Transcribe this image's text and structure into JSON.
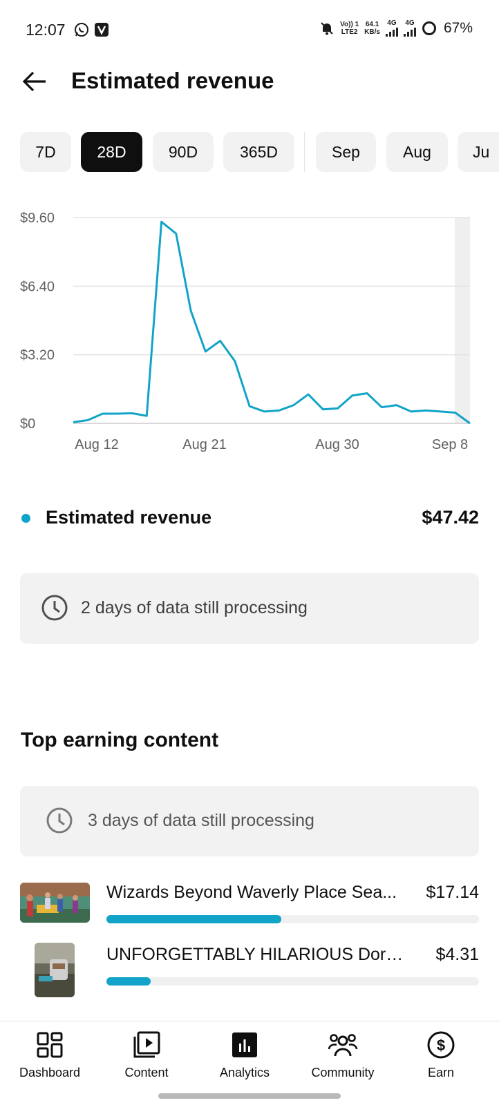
{
  "status_bar": {
    "time": "12:07",
    "volte": "Vo)) 1",
    "lte": "LTE2",
    "speed_value": "64.1",
    "speed_unit": "KB/s",
    "net1": "4G",
    "net2": "4G",
    "battery": "67%"
  },
  "header": {
    "title": "Estimated revenue"
  },
  "chips": [
    "7D",
    "28D",
    "90D",
    "365D",
    "Sep",
    "Aug",
    "Ju"
  ],
  "active_chip": "28D",
  "chart_data": {
    "type": "line",
    "title": "",
    "xlabel": "",
    "ylabel": "",
    "y_ticks": [
      "$9.60",
      "$6.40",
      "$3.20",
      "$0"
    ],
    "x_ticks": [
      "Aug 12",
      "Aug 21",
      "Aug 30",
      "Sep 8"
    ],
    "ylim": [
      0,
      9.6
    ],
    "x": [
      "Aug 12",
      "Aug 13",
      "Aug 14",
      "Aug 15",
      "Aug 16",
      "Aug 17",
      "Aug 18",
      "Aug 19",
      "Aug 20",
      "Aug 21",
      "Aug 22",
      "Aug 23",
      "Aug 24",
      "Aug 25",
      "Aug 26",
      "Aug 27",
      "Aug 28",
      "Aug 29",
      "Aug 30",
      "Aug 31",
      "Sep 1",
      "Sep 2",
      "Sep 3",
      "Sep 4",
      "Sep 5",
      "Sep 6",
      "Sep 7",
      "Sep 8"
    ],
    "series": [
      {
        "name": "Estimated revenue",
        "color": "#11a4c8",
        "values": [
          0.05,
          0.15,
          0.45,
          0.45,
          0.47,
          0.35,
          9.4,
          8.85,
          5.25,
          3.35,
          3.85,
          2.9,
          0.8,
          0.55,
          0.6,
          0.85,
          1.35,
          0.65,
          0.7,
          1.3,
          1.4,
          0.75,
          0.85,
          0.55,
          0.6,
          0.55,
          0.5,
          0.0
        ]
      }
    ],
    "processing_band": true,
    "grid": true
  },
  "summary": {
    "label": "Estimated revenue",
    "value": "$47.42"
  },
  "notice_1": "2 days of data still processing",
  "section_title": "Top earning content",
  "notice_2": "3 days of data still processing",
  "top_content": [
    {
      "title": "Wizards Beyond Waverly Place Sea...",
      "value": "$17.14",
      "share": 0.469
    },
    {
      "title": "UNFORGETTABLY HILARIOUS Dort ...",
      "value": "$4.31",
      "share": 0.118
    }
  ],
  "nav": [
    {
      "label": "Dashboard",
      "icon": "dashboard-icon"
    },
    {
      "label": "Content",
      "icon": "content-icon"
    },
    {
      "label": "Analytics",
      "icon": "analytics-icon"
    },
    {
      "label": "Community",
      "icon": "community-icon"
    },
    {
      "label": "Earn",
      "icon": "earn-icon"
    }
  ],
  "colors": {
    "accent": "#11a4c8",
    "chip_bg": "#f2f2f2",
    "chip_active": "#0f0f0f"
  }
}
